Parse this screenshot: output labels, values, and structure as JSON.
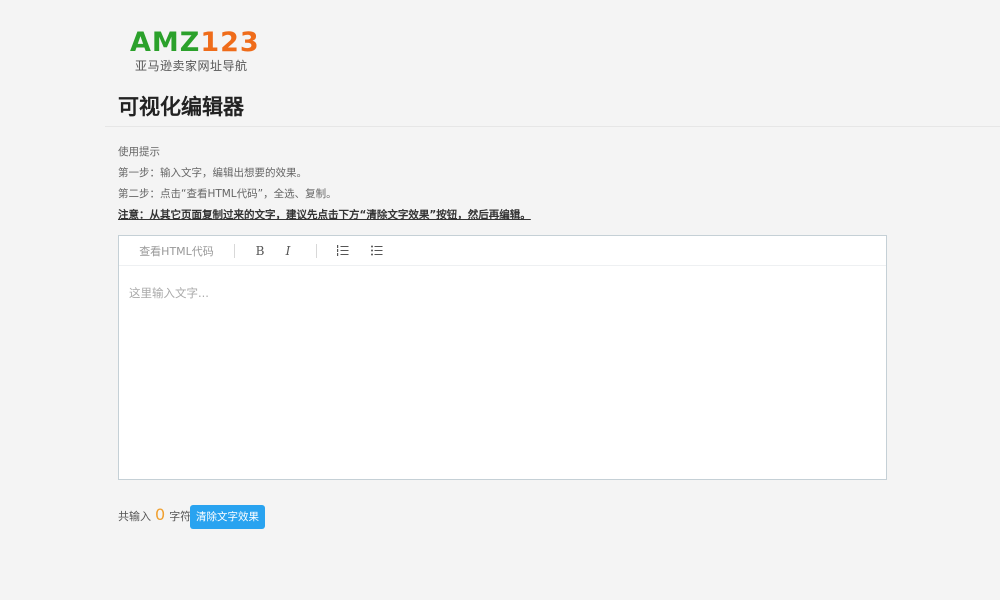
{
  "logo": {
    "main_green": "AMZ",
    "main_orange": "123",
    "subtitle": "亚马逊卖家网址导航",
    "colors": {
      "green": "#2ba12b",
      "orange": "#ef6c1a"
    }
  },
  "page": {
    "title": "可视化编辑器"
  },
  "tips": {
    "heading": "使用提示",
    "step1": "第一步：输入文字，编辑出想要的效果。",
    "step2": "第二步：点击“查看HTML代码”，全选、复制。",
    "warning": "注意：从其它页面复制过来的文字，建议先点击下方“清除文字效果”按钮，然后再编辑。"
  },
  "editor": {
    "toolbar": {
      "view_html": "查看HTML代码",
      "bold": "B",
      "italic": "I",
      "ordered_list_icon": "ordered-list-icon",
      "unordered_list_icon": "unordered-list-icon"
    },
    "placeholder": "这里输入文字..."
  },
  "footer": {
    "count_prefix": "共输入",
    "count": "0",
    "count_suffix": "字符",
    "clear_button": "清除文字效果",
    "button_color": "#29a3f0"
  }
}
